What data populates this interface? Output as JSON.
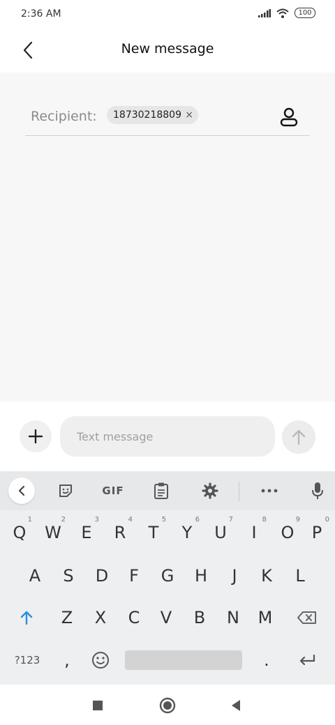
{
  "status_bar": {
    "time": "2:36 AM",
    "battery": "100",
    "icons": [
      "signal-icon",
      "wifi-icon",
      "battery-icon"
    ]
  },
  "header": {
    "title": "New message",
    "back_icon": "chevron-left-icon"
  },
  "recipient": {
    "label": "Recipient:",
    "chip": "18730218809",
    "chip_remove": "×",
    "contact_icon": "contact-icon"
  },
  "compose": {
    "placeholder": "Text message",
    "plus_icon": "plus-icon",
    "send_icon": "arrow-up-icon"
  },
  "keyboard": {
    "toolbar": {
      "gif_label": "GIF",
      "icons": [
        "chevron-left-icon",
        "sticker-icon",
        "clipboard-icon",
        "gear-icon",
        "more-icon",
        "mic-icon"
      ]
    },
    "row1": [
      {
        "k": "Q",
        "h": "1"
      },
      {
        "k": "W",
        "h": "2"
      },
      {
        "k": "E",
        "h": "3"
      },
      {
        "k": "R",
        "h": "4"
      },
      {
        "k": "T",
        "h": "5"
      },
      {
        "k": "Y",
        "h": "6"
      },
      {
        "k": "U",
        "h": "7"
      },
      {
        "k": "I",
        "h": "8"
      },
      {
        "k": "O",
        "h": "9"
      },
      {
        "k": "P",
        "h": "0"
      }
    ],
    "row2": [
      "A",
      "S",
      "D",
      "F",
      "G",
      "H",
      "J",
      "K",
      "L"
    ],
    "row3": [
      "Z",
      "X",
      "C",
      "V",
      "B",
      "N",
      "M"
    ],
    "symbols_label": "?123",
    "comma": ",",
    "period": "."
  },
  "colors": {
    "accent": "#2a8fe0",
    "background": "#f7f7f7",
    "keyboard": "#eeeff1"
  }
}
